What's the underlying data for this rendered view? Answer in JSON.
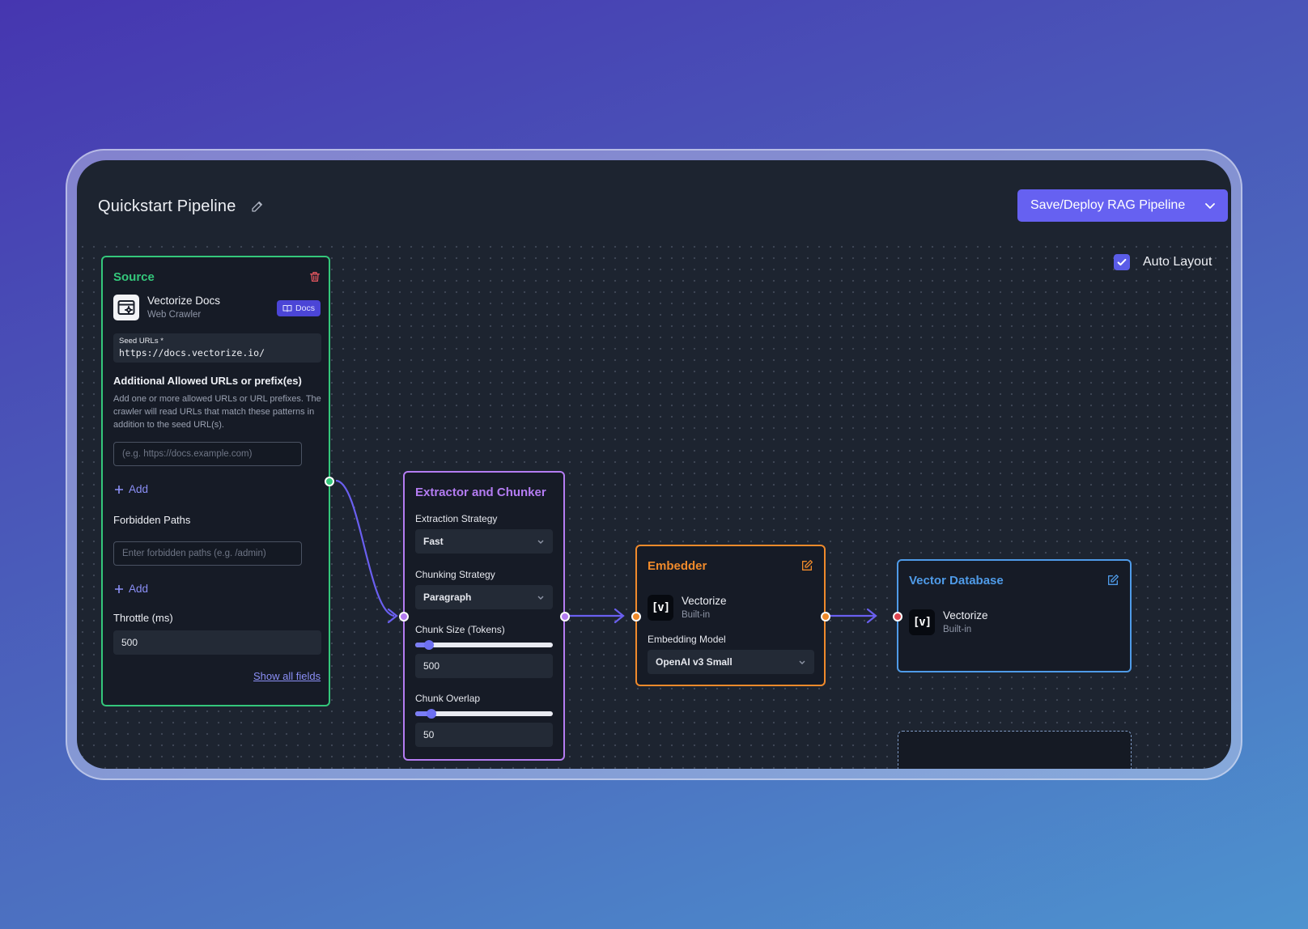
{
  "header": {
    "title": "Quickstart Pipeline",
    "deploy_label": "Save/Deploy RAG Pipeline",
    "auto_layout_label": "Auto Layout",
    "auto_layout_checked": true
  },
  "source": {
    "title": "Source",
    "connector_name": "Vectorize Docs",
    "connector_type": "Web Crawler",
    "docs_label": "Docs",
    "seed_label": "Seed URLs *",
    "seed_value": "https://docs.vectorize.io/",
    "allowed_heading": "Additional Allowed URLs or prefix(es)",
    "allowed_help": "Add one or more allowed URLs or URL prefixes. The crawler will read URLs that match these patterns in addition to the seed URL(s).",
    "allowed_placeholder": "(e.g. https://docs.example.com)",
    "add_label": "Add",
    "forbidden_heading": "Forbidden Paths",
    "forbidden_placeholder": "Enter forbidden paths (e.g. /admin)",
    "add_label_2": "Add",
    "throttle_label": "Throttle (ms)",
    "throttle_value": "500",
    "show_all_label": "Show all fields"
  },
  "extractor": {
    "title": "Extractor and Chunker",
    "extraction_label": "Extraction Strategy",
    "extraction_value": "Fast",
    "chunking_label": "Chunking Strategy",
    "chunking_value": "Paragraph",
    "chunk_size_label": "Chunk Size (Tokens)",
    "chunk_size_value": "500",
    "chunk_size_fraction": 0.1,
    "chunk_overlap_label": "Chunk Overlap",
    "chunk_overlap_value": "50",
    "chunk_overlap_fraction": 0.12
  },
  "embedder": {
    "title": "Embedder",
    "provider_name": "Vectorize",
    "provider_sub": "Built-in",
    "logo_text": "[v]",
    "model_label": "Embedding Model",
    "model_value": "OpenAI v3 Small"
  },
  "vector_db": {
    "title": "Vector Database",
    "provider_name": "Vectorize",
    "provider_sub": "Built-in",
    "logo_text": "[v]"
  },
  "colors": {
    "source": "#34c77b",
    "extractor": "#b47cf2",
    "embedder": "#f08a2b",
    "vector_db": "#4f9be8",
    "accent": "#6661f1",
    "edge": "#6a5ff0"
  }
}
